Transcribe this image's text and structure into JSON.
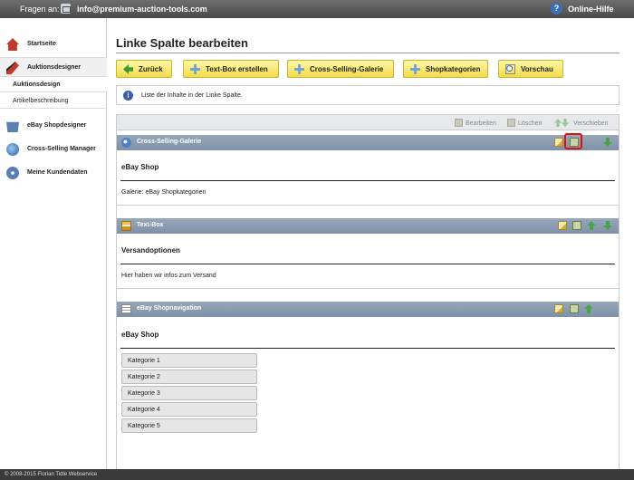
{
  "topbar": {
    "ask_label": "Fragen an:",
    "email": "info@premium-auction-tools.com",
    "help": "Online-Hilfe"
  },
  "sidebar": {
    "items": [
      {
        "label": "Startseite",
        "icon": "home-icon"
      },
      {
        "label": "Auktionsdesigner",
        "icon": "brush-icon"
      },
      {
        "label": "eBay Shopdesigner",
        "icon": "shop-icon"
      },
      {
        "label": "Cross-Selling Manager",
        "icon": "cross-selling-icon"
      },
      {
        "label": "Meine Kundendaten",
        "icon": "gear-icon"
      }
    ],
    "subitems": [
      {
        "label": "Auktionsdesign",
        "selected": true
      },
      {
        "label": "Artikelbeschreibung",
        "selected": false
      }
    ]
  },
  "main": {
    "title": "Linke Spalte bearbeiten",
    "buttons": {
      "back": "Zurück",
      "textbox": "Text-Box erstellen",
      "crossselling": "Cross-Selling-Galerie",
      "categories": "Shopkategorien",
      "preview": "Vorschau"
    },
    "info_text": "Liste der Inhalte in der Linke Spalte.",
    "actions": {
      "edit": "Bearbeiten",
      "delete": "Löschen",
      "move": "Verschieben"
    },
    "boxes": [
      {
        "header": "Cross-Selling-Galerie",
        "title": "eBay Shop",
        "text": "Galerie: eBay Shopkategorien"
      },
      {
        "header": "Text-Box",
        "title": "Versandoptionen",
        "text": "Hier haben wir infos zum Versand"
      },
      {
        "header": "eBay Shopnavigation",
        "title": "eBay Shop",
        "categories": [
          "Kategorie 1",
          "Kategorie 2",
          "Kategorie 3",
          "Kategorie 4",
          "Kategorie 5"
        ]
      }
    ]
  },
  "footer": {
    "copyright": "© 2008-2015 Florian Tidle Webservice"
  }
}
